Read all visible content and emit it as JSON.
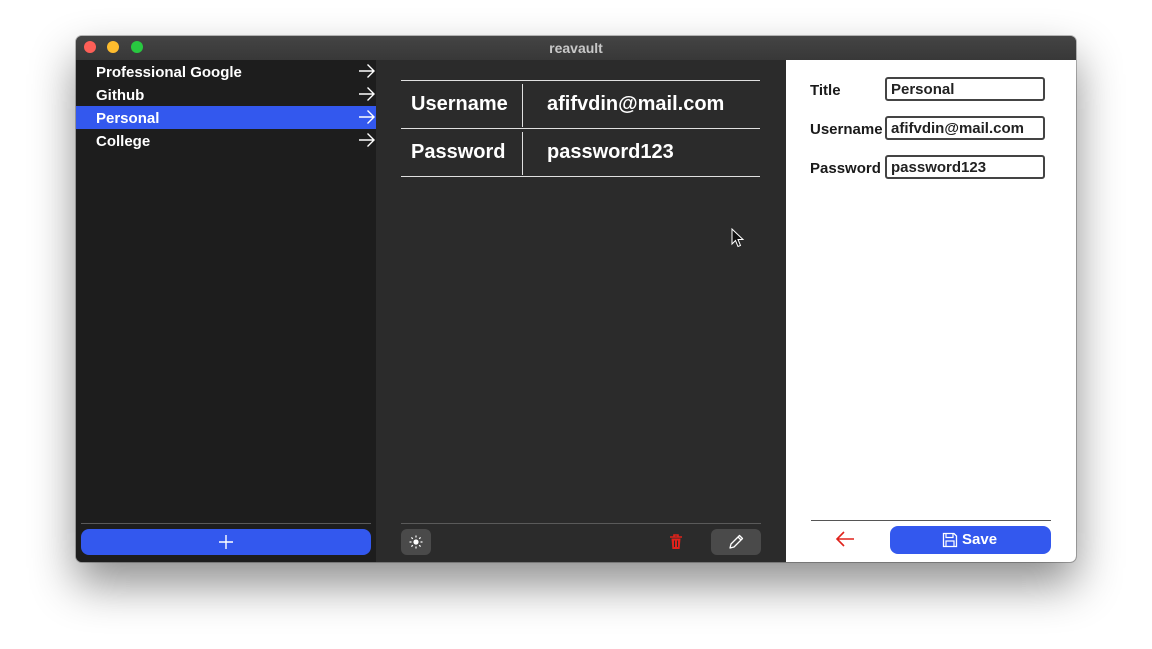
{
  "window": {
    "title": "reavault"
  },
  "sidebar": {
    "items": [
      {
        "label": "Professional Google",
        "selected": false,
        "icon": "arrow-right-icon"
      },
      {
        "label": "Github",
        "selected": false,
        "icon": "arrow-right-icon"
      },
      {
        "label": "Personal",
        "selected": true,
        "icon": "arrow-right-icon"
      },
      {
        "label": "College",
        "selected": false,
        "icon": "arrow-right-icon"
      }
    ],
    "add_icon": "plus-icon"
  },
  "detail": {
    "rows": [
      {
        "label": "Username",
        "value": "afifvdin@mail.com"
      },
      {
        "label": "Password",
        "value": "password123"
      }
    ],
    "toolbar": {
      "theme_icon": "sun-icon",
      "delete_icon": "trash-icon",
      "edit_icon": "pencil-icon"
    }
  },
  "form": {
    "fields": [
      {
        "label": "Title",
        "value": "Personal"
      },
      {
        "label": "Username",
        "value": "afifvdin@mail.com"
      },
      {
        "label": "Password",
        "value": "password123"
      }
    ],
    "back_icon": "arrow-left-icon",
    "save_label": "Save",
    "save_icon": "floppy-disk-icon"
  },
  "colors": {
    "accent": "#3358ee",
    "sidebar_bg": "#1d1d1d",
    "detail_bg": "#2b2b2b",
    "danger": "#e0221b"
  }
}
